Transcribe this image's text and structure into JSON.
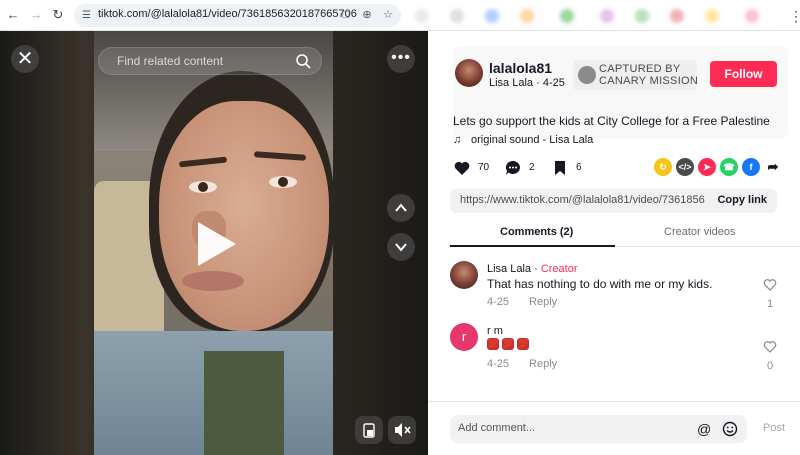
{
  "browser": {
    "url": "tiktok.com/@lalalola81/video/7361856320187665706"
  },
  "video": {
    "search_placeholder": "Find related content"
  },
  "post": {
    "username": "lalalola81",
    "display_name": "Lisa Lala",
    "date": "4-25",
    "canary_line1": "CAPTURED BY",
    "canary_line2": "CANARY MISSION",
    "follow_label": "Follow",
    "caption": "Lets go support the kids at City College for a Free Palestine",
    "sound": "original sound - Lisa Lala"
  },
  "actions": {
    "likes": "70",
    "comments": "2",
    "saves": "6"
  },
  "share": {
    "link": "https://www.tiktok.com/@lalalola81/video/736185632...",
    "copy_label": "Copy link"
  },
  "tabs": {
    "comments": "Comments (2)",
    "creator": "Creator videos"
  },
  "comments": [
    {
      "name": "Lisa Lala",
      "tag": "Creator",
      "text": "That has nothing to do with me or my kids.",
      "date": "4-25",
      "reply": "Reply",
      "likes": "1"
    },
    {
      "name": "r m",
      "avatar_letter": "r",
      "emojis": [
        "💯",
        "💯",
        "💯"
      ],
      "date": "4-25",
      "reply": "Reply",
      "likes": "0"
    }
  ],
  "composer": {
    "placeholder": "Add comment...",
    "post_label": "Post"
  },
  "colors": {
    "brand_red": "#fe2c55",
    "creator_tag": "#fe2c55",
    "avatar_r": "#e8386b"
  }
}
